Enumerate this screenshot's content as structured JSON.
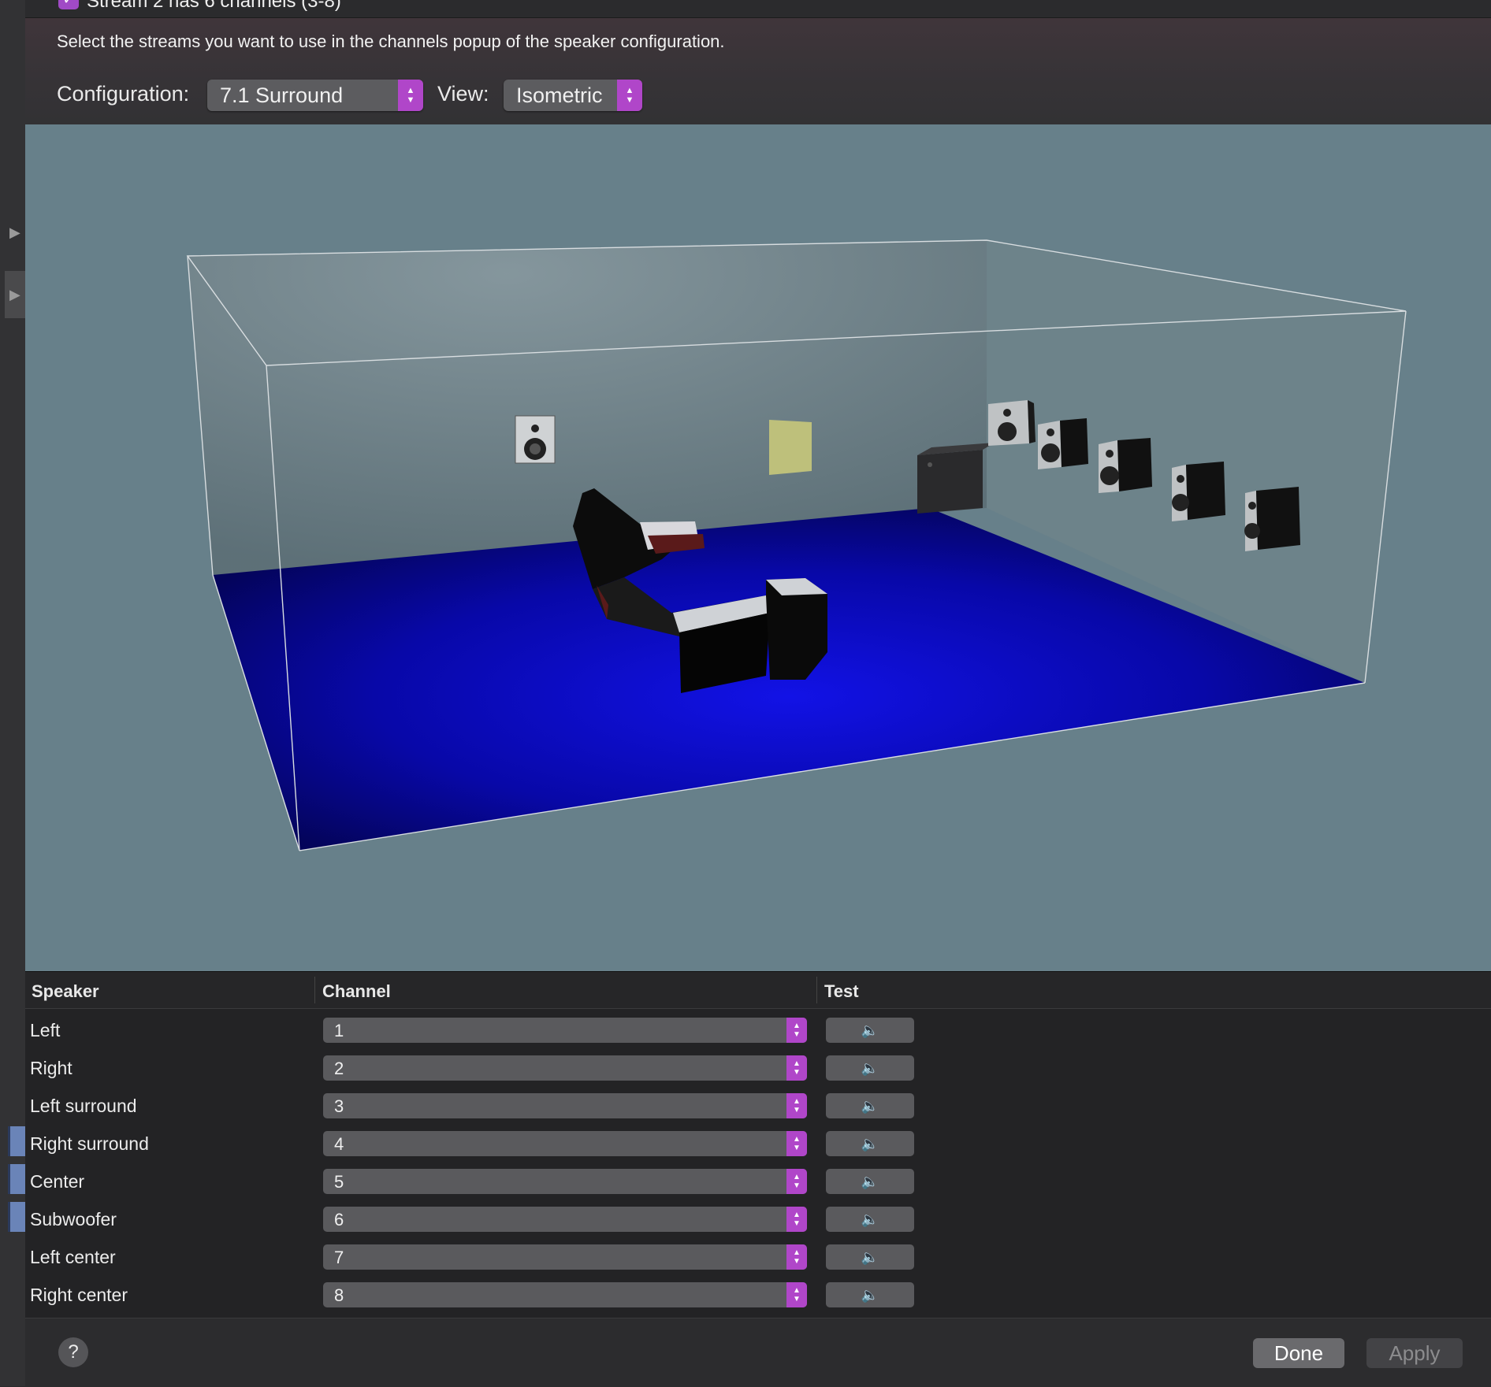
{
  "stream": {
    "label": "Stream 2 has 6 channels (3-8)",
    "checked": true
  },
  "instructions": "Select the streams you want to use in the channels popup of the speaker configuration.",
  "configuration": {
    "label": "Configuration:",
    "value": "7.1 Surround"
  },
  "view": {
    "label": "View:",
    "value": "Isometric"
  },
  "table": {
    "headers": {
      "speaker": "Speaker",
      "channel": "Channel",
      "test": "Test"
    },
    "rows": [
      {
        "speaker": "Left",
        "channel": "1"
      },
      {
        "speaker": "Right",
        "channel": "2"
      },
      {
        "speaker": "Left surround",
        "channel": "3"
      },
      {
        "speaker": "Right surround",
        "channel": "4"
      },
      {
        "speaker": "Center",
        "channel": "5"
      },
      {
        "speaker": "Subwoofer",
        "channel": "6"
      },
      {
        "speaker": "Left center",
        "channel": "7"
      },
      {
        "speaker": "Right center",
        "channel": "8"
      }
    ]
  },
  "footer": {
    "help": "?",
    "done": "Done",
    "apply": "Apply"
  },
  "colors": {
    "accent": "#b046c9",
    "floor": "#0b0bd0",
    "scene_bg": "#67808a"
  },
  "icons": {
    "test": "speaker-icon",
    "stepper": "up-down-chevron-icon",
    "disclosure": "triangle-right-icon"
  }
}
